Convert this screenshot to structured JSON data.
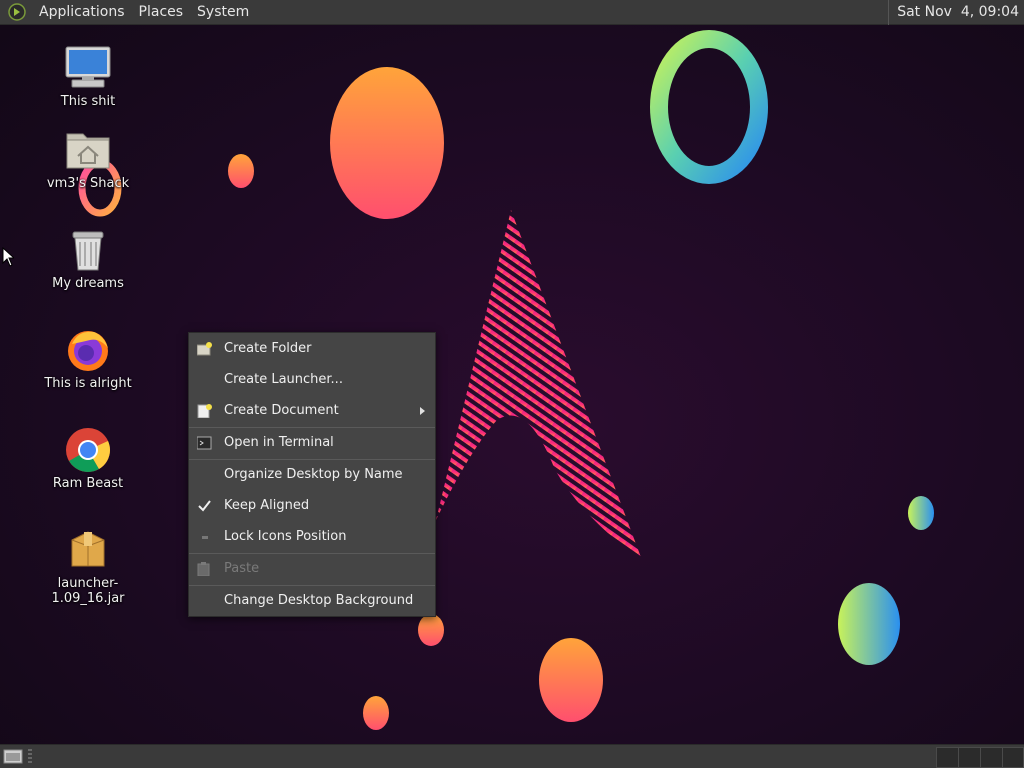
{
  "top_panel": {
    "menus": [
      "Applications",
      "Places",
      "System"
    ],
    "clock": "Sat Nov  4, 09:04"
  },
  "desktop_icons": [
    {
      "label": "This shit",
      "icon": "computer-icon"
    },
    {
      "label": "vm3's Shack",
      "icon": "home-folder-icon"
    },
    {
      "label": "My dreams",
      "icon": "trash-icon"
    },
    {
      "label": "This is alright",
      "icon": "firefox-icon"
    },
    {
      "label": "Ram Beast",
      "icon": "chrome-icon"
    },
    {
      "label": "launcher-1.09_16.jar",
      "icon": "package-icon"
    }
  ],
  "context_menu": {
    "items": [
      {
        "label": "Create Folder",
        "icon": "folder-new-icon",
        "enabled": true
      },
      {
        "label": "Create Launcher...",
        "enabled": true
      },
      {
        "label": "Create Document",
        "icon": "document-new-icon",
        "submenu": true,
        "enabled": true
      },
      {
        "label": "Open in Terminal",
        "icon": "terminal-icon",
        "enabled": true
      },
      {
        "label": "Organize Desktop by Name",
        "enabled": true
      },
      {
        "label": "Keep Aligned",
        "checked": true,
        "enabled": true
      },
      {
        "label": "Lock Icons Position",
        "checked": false,
        "enabled": true
      },
      {
        "label": "Paste",
        "icon": "paste-icon",
        "enabled": false
      },
      {
        "label": "Change Desktop Background",
        "enabled": true
      }
    ]
  },
  "colors": {
    "panel": "#3a3a3a",
    "menu_bg": "#454545",
    "desktop_bg": "#1c0a22"
  }
}
